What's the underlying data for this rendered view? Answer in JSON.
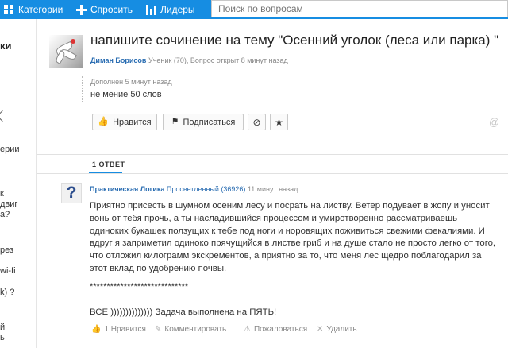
{
  "topbar": {
    "categories": "Категории",
    "ask": "Спросить",
    "leaders": "Лидеры",
    "search_placeholder": "Поиск по вопросам"
  },
  "sidebar": {
    "items": [
      "ки",
      "ерии",
      "к",
      "двиг",
      "а?",
      "рез",
      "wi-fi",
      "k) ?",
      "й",
      "ь"
    ]
  },
  "question": {
    "title": "напишите сочинение на тему \"Осенний уголок (леса или парка) \"",
    "author": "Диман Борисов",
    "meta": "Ученик (70), Вопрос открыт 8 минут назад",
    "added_label": "Дополнен 5 минут назад",
    "added_text": "не мение 50 слов"
  },
  "buttons": {
    "like": "Нравится",
    "subscribe": "Подписаться"
  },
  "answers": {
    "tab": "1 ОТВЕТ",
    "answer": {
      "author": "Практическая Логика",
      "rank": "Просветленный (36926)",
      "time": "11 минут назад",
      "text": "Приятно присесть в шумном осеним лесу и посрать на листву. Ветер подувает в жопу и уносит вонь от тебя прочь, а ты насладившийся процессом и умиротворенно рассматриваешь одиноких букашек ползущих к тебе под ноги и норовящих поживиться свежими фекалиями. И вдруг я заприметил одиноко прячущийся в листве гриб и на душе стало не просто легко от того, что отложил килограмм экскрементов, а приятно за то, что меня лес щедро поблагодарил за этот вклад по удобрению почвы.",
      "stars": "*****************************",
      "final": "ВСЕ )))))))))))))) Задача выполнена на ПЯТЬ!",
      "actions": {
        "likes": "1 Нравится",
        "comment": "Комментировать",
        "report": "Пожаловаться",
        "delete": "Удалить"
      }
    }
  }
}
